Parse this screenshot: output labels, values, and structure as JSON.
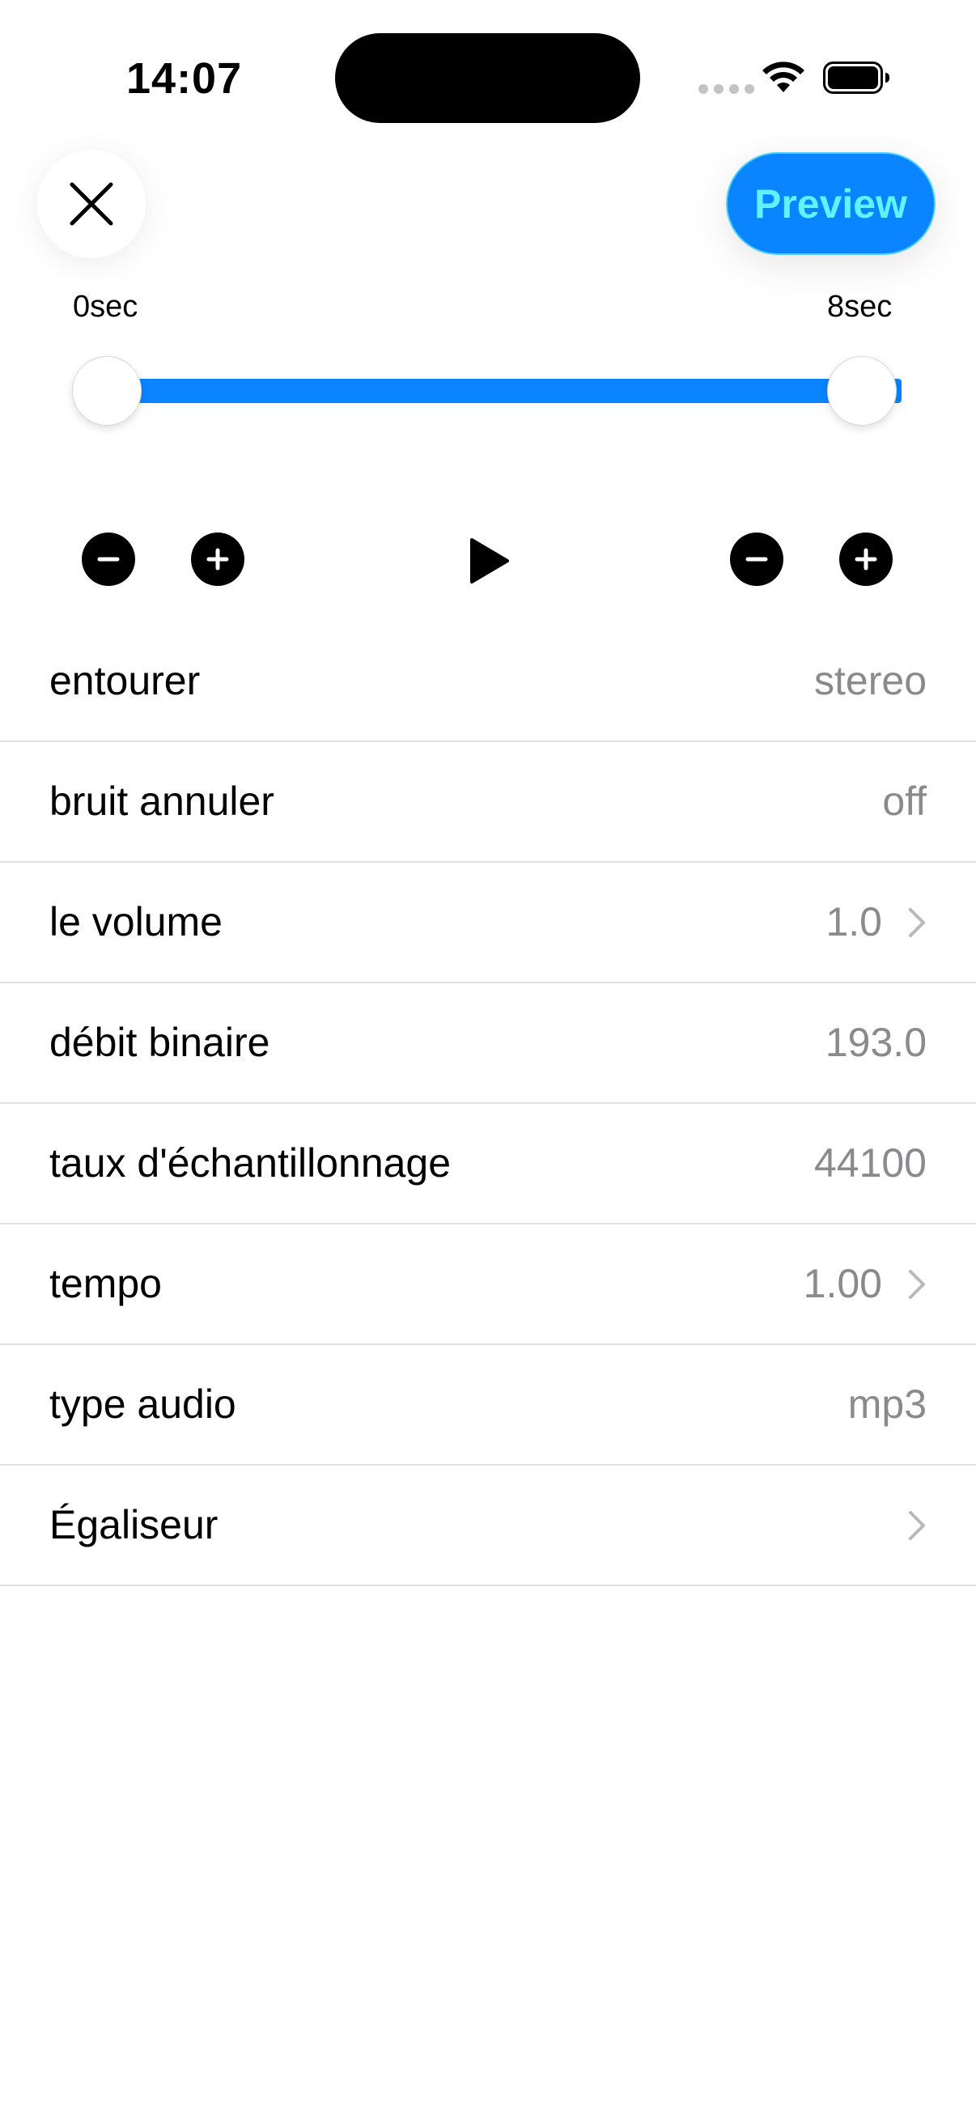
{
  "status_bar": {
    "time": "14:07",
    "icons": [
      "cellular-dots-icon",
      "wifi-icon",
      "battery-icon"
    ]
  },
  "toolbar": {
    "close_icon": "close-icon",
    "preview_label": "Preview"
  },
  "trim": {
    "start_label": "0sec",
    "end_label": "8sec",
    "start_fraction": 0,
    "end_fraction": 1
  },
  "transport": {
    "icons": [
      "minus-icon",
      "plus-icon",
      "play-icon",
      "minus-icon",
      "plus-icon"
    ]
  },
  "settings": {
    "rows": [
      {
        "label": "entourer",
        "value": "stereo",
        "chevron": false
      },
      {
        "label": "bruit annuler",
        "value": "off",
        "chevron": false
      },
      {
        "label": "le volume",
        "value": "1.0",
        "chevron": true
      },
      {
        "label": "débit binaire",
        "value": "193.0",
        "chevron": false
      },
      {
        "label": "taux d'échantillonnage",
        "value": "44100",
        "chevron": false
      },
      {
        "label": "tempo",
        "value": "1.00",
        "chevron": true
      },
      {
        "label": "type audio",
        "value": "mp3",
        "chevron": false
      },
      {
        "label": "Égaliseur",
        "value": "",
        "chevron": true
      }
    ]
  },
  "colors": {
    "accent": "#0a84ff",
    "preview_text": "#5ef3ff",
    "secondary_text": "#8a8a8e",
    "separator": "#e2e2e2"
  }
}
